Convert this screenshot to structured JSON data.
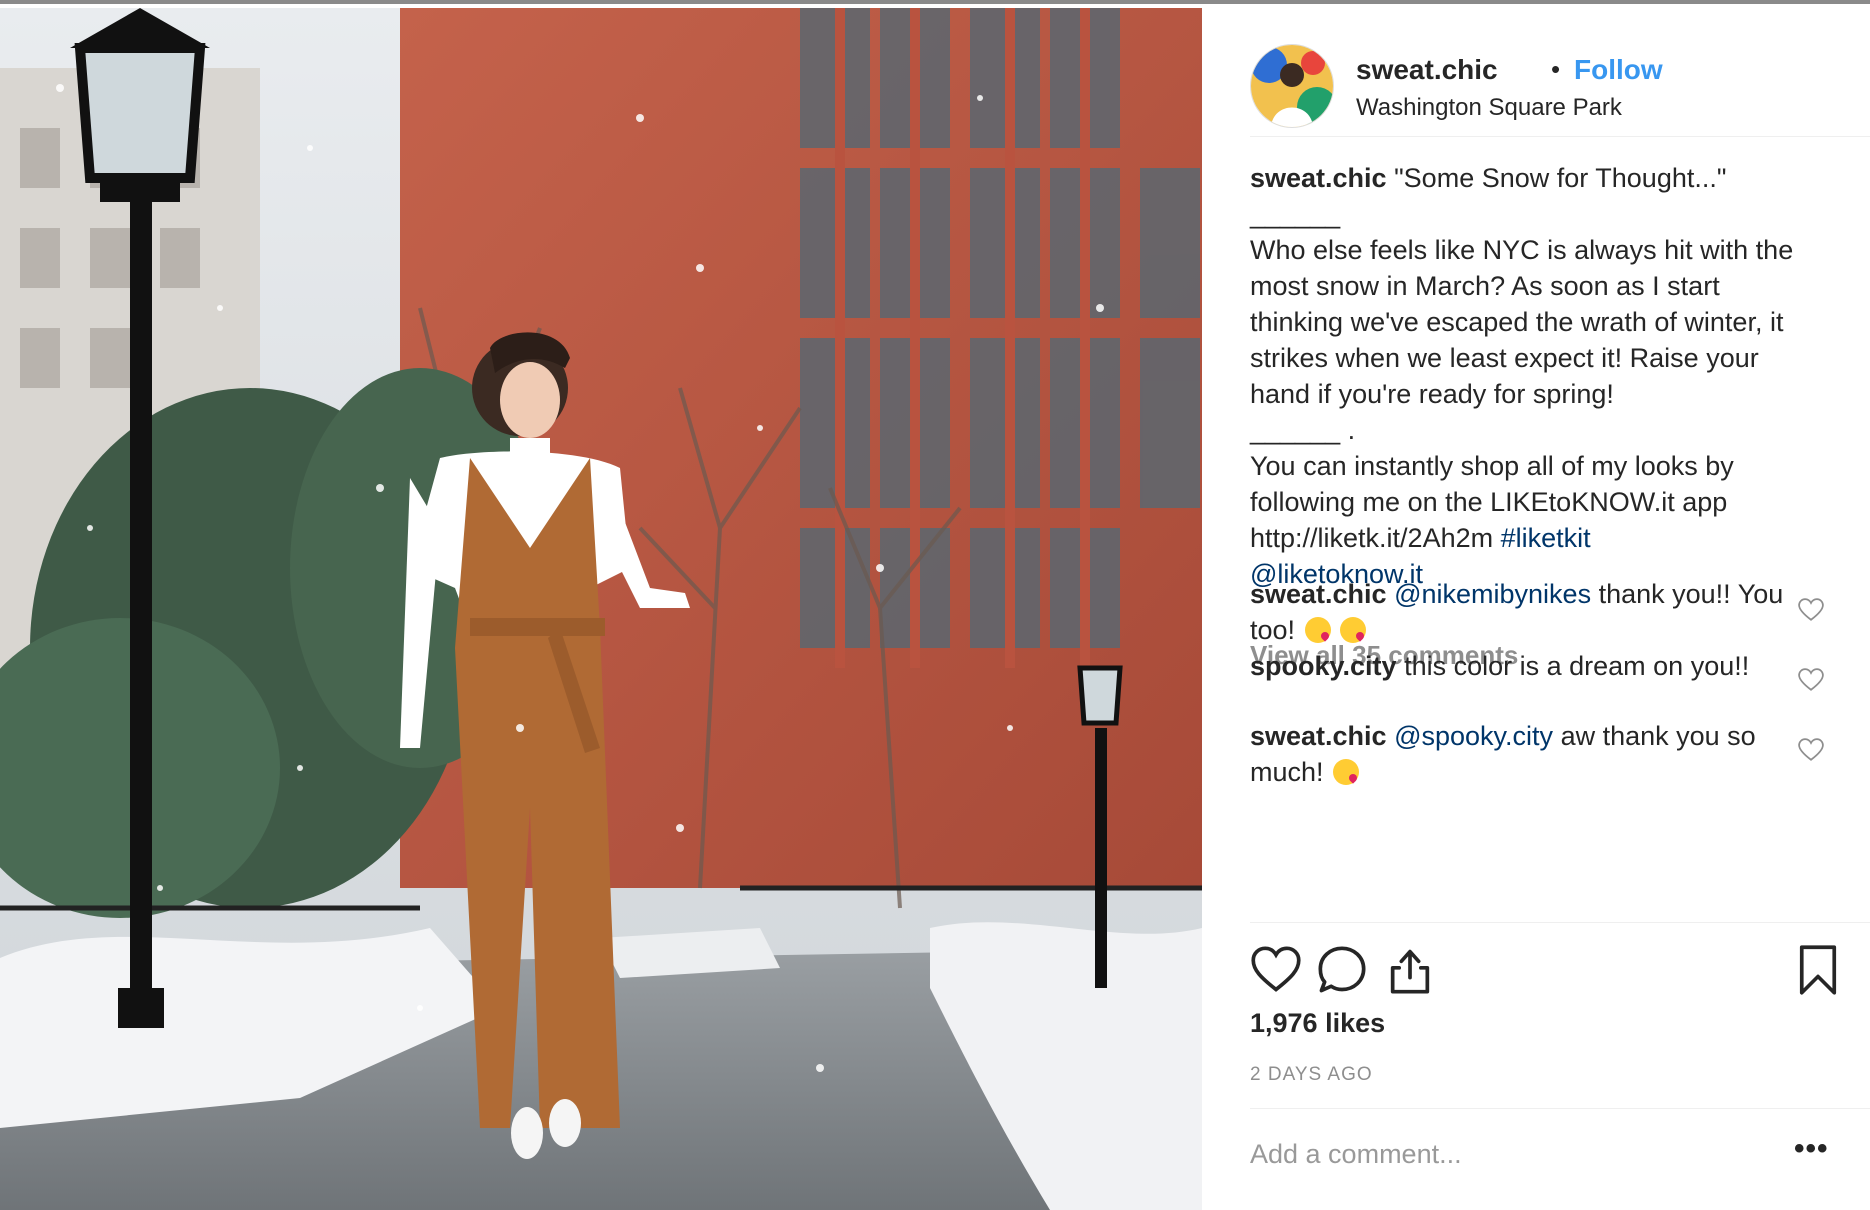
{
  "post": {
    "username": "sweat.chic",
    "separator": "•",
    "follow_label": "Follow",
    "location": "Washington Square Park",
    "caption": {
      "username": "sweat.chic",
      "line1": "\"Some Snow for Thought...\"",
      "rule1": "______",
      "body1": "Who else feels like NYC is always hit with the most snow in March? As soon as I start thinking we've escaped the wrath of winter, it strikes when we least expect it! Raise your hand if you're ready for spring!",
      "rule2": "______ .",
      "body2": "You can instantly shop all of my looks by following me on the LIKEtoKNOW.it app",
      "url": "http://liketk.it/2Ah2m",
      "hashtag": "#liketkit",
      "mention": "@liketoknow.it"
    },
    "view_all_comments": "View all 35 comments",
    "comments": [
      {
        "username": "sweat.chic",
        "mention": "@nikemibynikes",
        "text": "thank you!! You too!",
        "emoji_count": 2
      },
      {
        "username": "spooky.city",
        "mention": "",
        "text": "this color is a dream on you!!",
        "emoji_count": 0
      },
      {
        "username": "sweat.chic",
        "mention": "@spooky.city",
        "text": "aw thank you so much!",
        "emoji_count": 1
      }
    ],
    "icons": {
      "like": "heart-icon",
      "comment": "speech-bubble-icon",
      "share": "share-icon",
      "save": "bookmark-icon",
      "comment_like": "heart-icon",
      "more": "more-options-icon"
    },
    "likes": "1,976 likes",
    "timestamp": "2 DAYS AGO",
    "add_comment_placeholder": "Add a comment...",
    "more_label": "•••",
    "colors": {
      "link": "#3897f0",
      "mention": "#003569",
      "muted": "#8e8e8e",
      "text": "#262626"
    }
  }
}
